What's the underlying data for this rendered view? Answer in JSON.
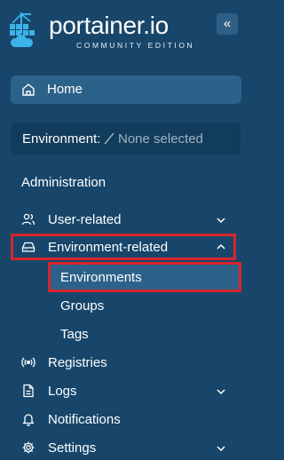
{
  "brand": {
    "name": "portainer.io",
    "edition": "COMMUNITY EDITION"
  },
  "sidebar": {
    "collapse_icon": "«",
    "home_label": "Home",
    "environment_label": "Environment:",
    "environment_value": "None selected",
    "section_title": "Administration",
    "items": [
      {
        "label": "User-related",
        "icon": "users-icon",
        "chevron": "down"
      },
      {
        "label": "Environment-related",
        "icon": "drive-icon",
        "chevron": "up",
        "expanded": true,
        "children": [
          "Environments",
          "Groups",
          "Tags"
        ],
        "active_child": "Environments"
      },
      {
        "label": "Registries",
        "icon": "radio-icon"
      },
      {
        "label": "Logs",
        "icon": "file-icon",
        "chevron": "down"
      },
      {
        "label": "Notifications",
        "icon": "bell-icon"
      },
      {
        "label": "Settings",
        "icon": "gear-icon",
        "chevron": "down"
      }
    ]
  },
  "colors": {
    "background": "#17466a",
    "active": "#2c6289",
    "highlight_border": "#d9242b"
  }
}
